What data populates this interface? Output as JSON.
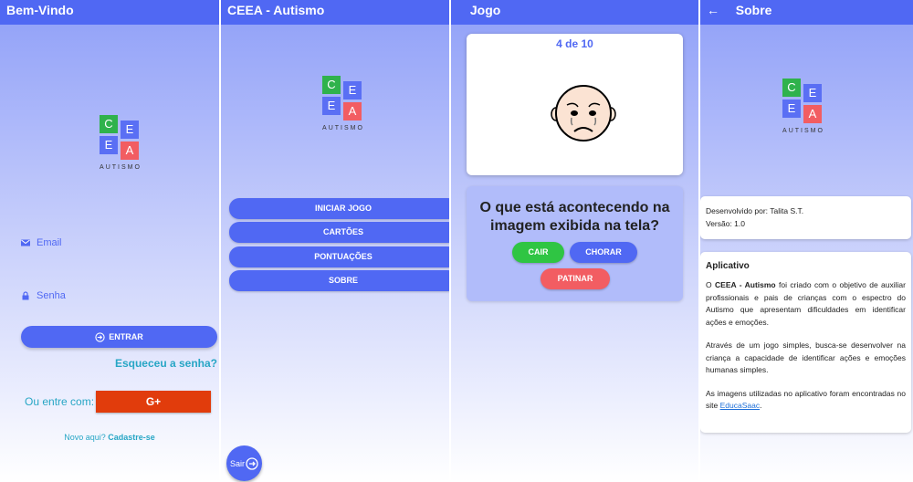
{
  "logo": {
    "c": "C",
    "e1": "E",
    "e2": "E",
    "a": "A",
    "word": "AUTISMO"
  },
  "login": {
    "title": "Bem-Vindo",
    "email_label": "Email",
    "password_label": "Senha",
    "enter_label": "ENTRAR",
    "forgot_label": "Esqueceu a senha?",
    "or_label": "Ou entre com:",
    "google_label": "G+",
    "signup_prefix": "Novo aqui?",
    "signup_link": "Cadastre-se"
  },
  "home": {
    "title": "CEEA - Autismo",
    "menu": [
      "INICIAR JOGO",
      "CARTÕES",
      "PONTUAÇÕES",
      "SOBRE"
    ],
    "exit_label": "Sair"
  },
  "game": {
    "title": "Jogo",
    "counter": "4 de 10",
    "question": "O que está acontecendo na imagem exibida na tela?",
    "answers": [
      "CAIR",
      "CHORAR",
      "PATINAR"
    ]
  },
  "about": {
    "title": "Sobre",
    "developer": "Desenvolvido por: Talita S.T.",
    "version": "Versão: 1.0",
    "section_title": "Aplicativo",
    "p1_prefix": "O ",
    "p1_bold": "CEEA - Autismo",
    "p1_rest": " foi criado com o objetivo de auxiliar profissionais e pais de crianças com o espectro do Autismo que apresentam dificuldades em identificar ações e emoções.",
    "p2": "Através de um jogo simples, busca-se desenvolver na criança a capacidade de identificar ações e emoções humanas simples.",
    "p3_prefix": "As imagens utilizadas no aplicativo foram encontradas no site ",
    "p3_link": "EducaSaac",
    "p3_suffix": "."
  },
  "colors": {
    "primary": "#5068f3",
    "green": "#2fc543",
    "red": "#f25d62",
    "google": "#e13c0c",
    "accent_text": "#27a6c5"
  }
}
